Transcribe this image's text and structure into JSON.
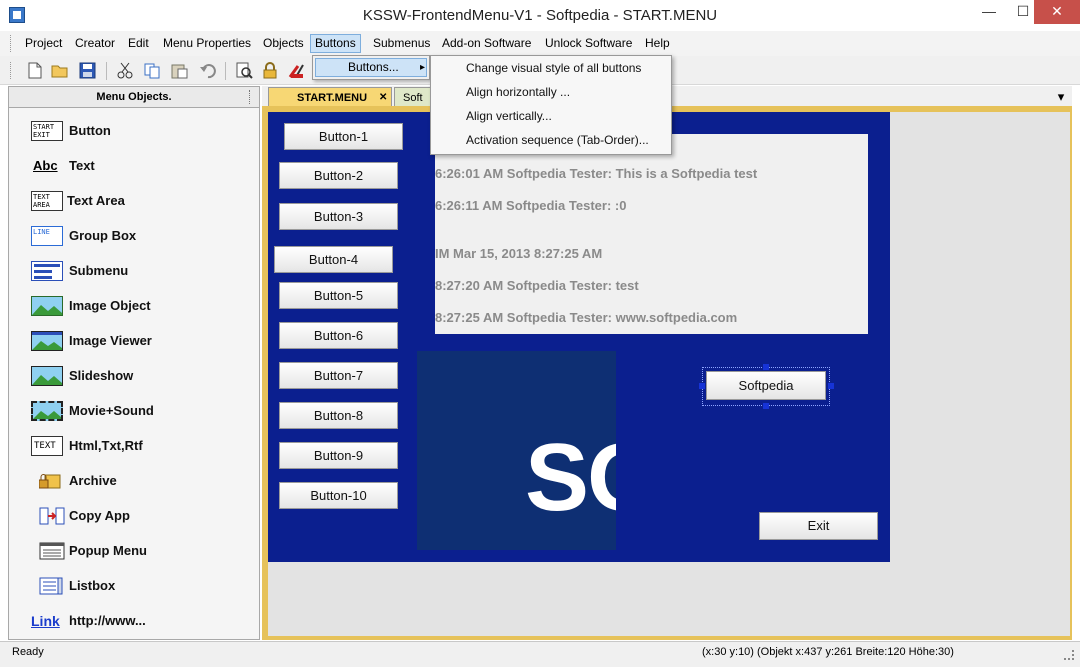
{
  "window": {
    "title": "KSSW-FrontendMenu-V1  -  Softpedia  -  START.MENU",
    "minimize": "—",
    "maximize": "☐",
    "close": "✕"
  },
  "menubar": {
    "items": [
      "Project",
      "Creator",
      "Edit",
      "Menu Properties",
      "Objects",
      "Buttons",
      "Submenus",
      "Add-on Software",
      "Unlock Software",
      "Help"
    ],
    "active": "Buttons"
  },
  "buttons_menu": {
    "item": "Buttons...",
    "arrow": "▸",
    "submenu": [
      "Change visual style of all buttons",
      "Align horizontally ...",
      "Align vertically...",
      "Activation sequence (Tab-Order)..."
    ]
  },
  "toolbar": {
    "icons": [
      "new-file-icon",
      "open-folder-icon",
      "save-icon",
      "cut-icon",
      "copy-icon",
      "paste-icon",
      "undo-icon",
      "preview-icon",
      "lock-icon",
      "tools-icon"
    ]
  },
  "left_panel": {
    "header": "Menu Objects.",
    "items": [
      {
        "label": "Button",
        "icon": "START EXIT"
      },
      {
        "label": "Text",
        "icon": "Abc"
      },
      {
        "label": "Text Area",
        "icon": "TEXT AREA"
      },
      {
        "label": "Group Box",
        "icon": "LINE"
      },
      {
        "label": "Submenu",
        "icon": ""
      },
      {
        "label": "Image Object",
        "icon": ""
      },
      {
        "label": "Image Viewer",
        "icon": ""
      },
      {
        "label": "Slideshow",
        "icon": ""
      },
      {
        "label": "Movie+Sound",
        "icon": ""
      },
      {
        "label": "Html,Txt,Rtf",
        "icon": "TEXT"
      },
      {
        "label": "Archive",
        "icon": ""
      },
      {
        "label": "Copy App",
        "icon": ""
      },
      {
        "label": "Popup Menu",
        "icon": ""
      },
      {
        "label": "Listbox",
        "icon": ""
      },
      {
        "label": "http://www...",
        "icon": "Link"
      }
    ]
  },
  "tabs": [
    {
      "label": "START.MENU",
      "close": "✕",
      "active": true
    },
    {
      "label": "Soft",
      "active": false
    }
  ],
  "tab_dropdown": "▾",
  "form": {
    "buttons": [
      "Button-1",
      "Button-2",
      "Button-3",
      "Button-4",
      "Button-5",
      "Button-6",
      "Button-7",
      "Button-8",
      "Button-9",
      "Button-10"
    ],
    "text_lines": [
      "6:26:01 AM Softpedia Tester: This is a Softpedia test",
      "6:26:11 AM Softpedia Tester: :0",
      "IM Mar 15, 2013 8:27:25 AM",
      "8:27:20 AM Softpedia Tester: test",
      "8:27:25 AM Softpedia Tester: www.softpedia.com"
    ],
    "logo_text": "SO",
    "selected_button": "Softpedia",
    "exit_button": "Exit"
  },
  "statusbar": {
    "left": "Ready",
    "right": "(x:30 y:10) (Objekt x:437 y:261 Breite:120 Höhe:30)"
  },
  "colors": {
    "form_background": "#0b1f8f",
    "design_border": "#e6c25a",
    "menu_highlight": "#cde3f7",
    "close_button": "#c7504a"
  }
}
